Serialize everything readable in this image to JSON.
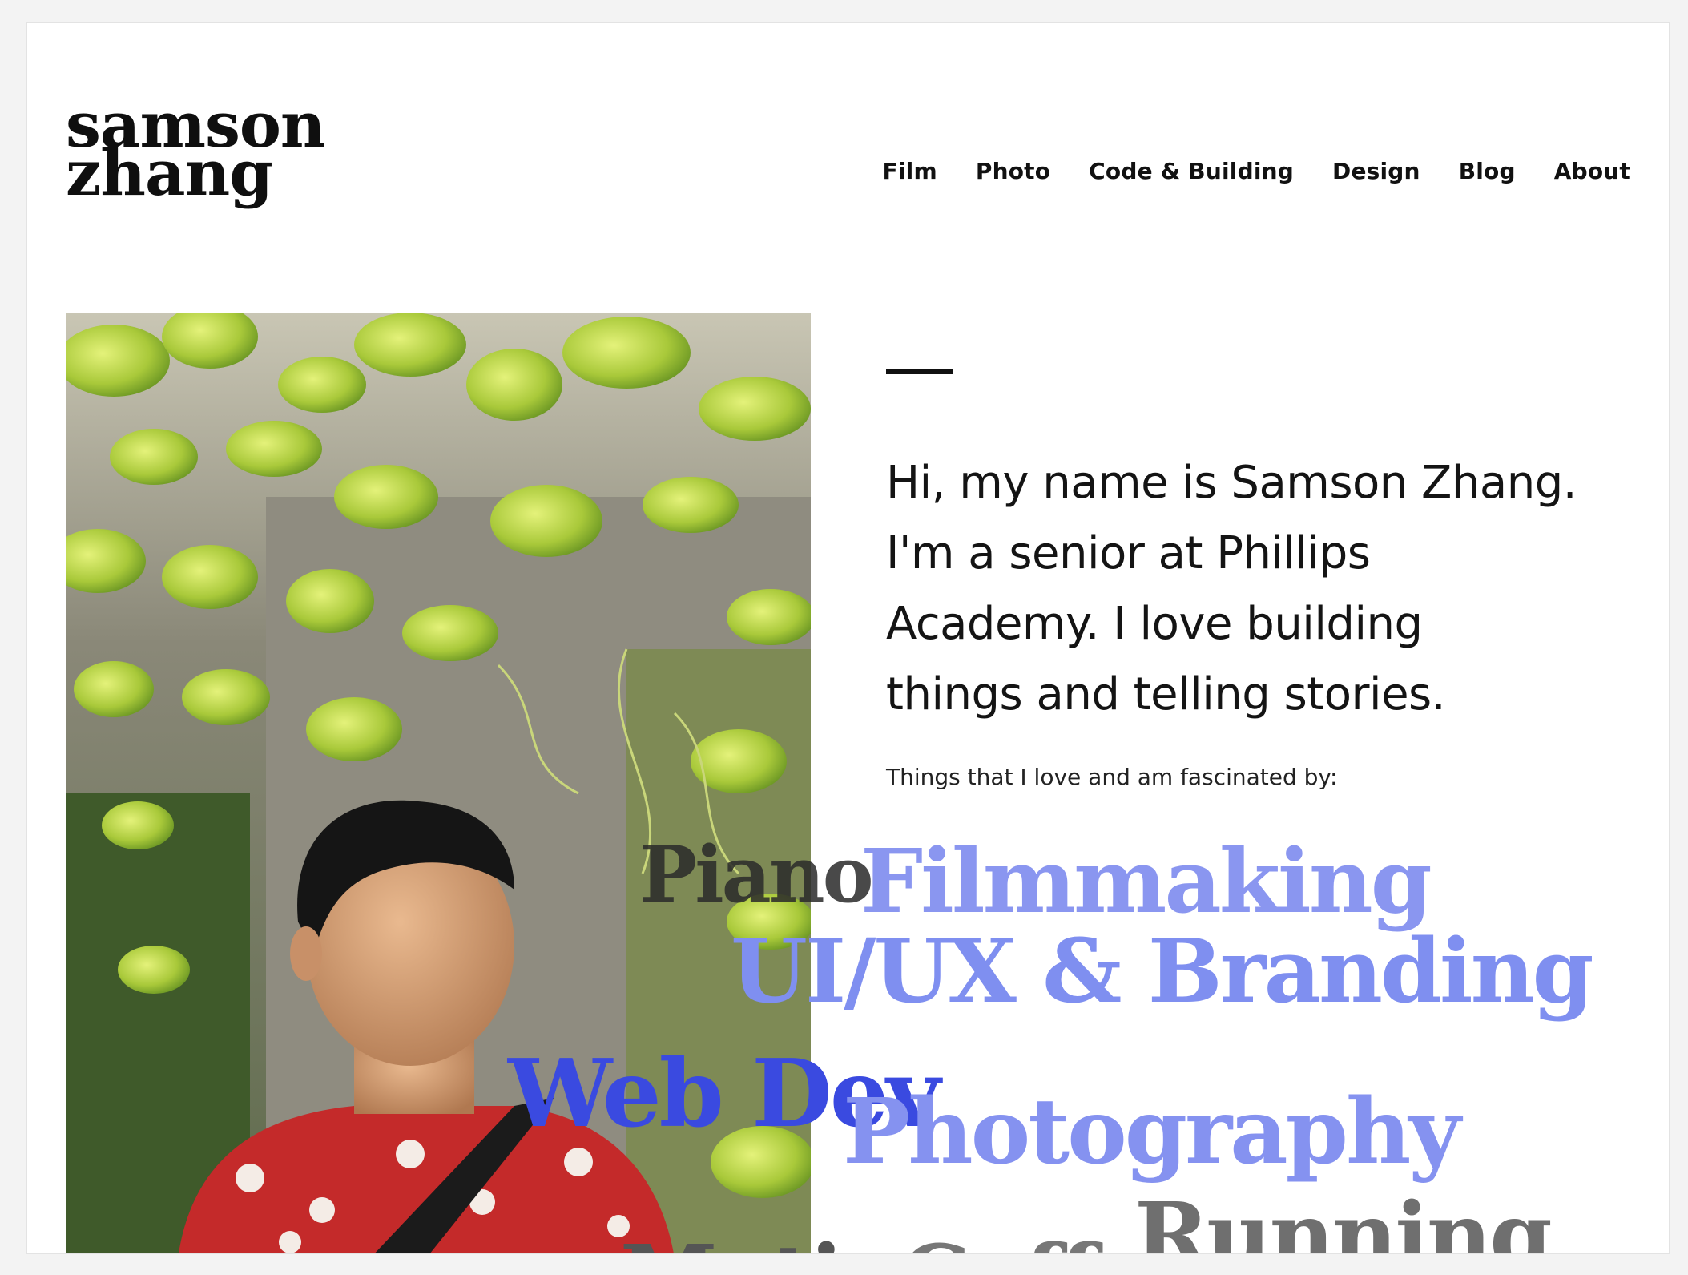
{
  "site": {
    "logo_line1": "samson",
    "logo_line2": "zhang"
  },
  "nav": {
    "items": [
      "Film",
      "Photo",
      "Code & Building",
      "Design",
      "Blog",
      "About"
    ]
  },
  "hero": {
    "intro_lines": [
      "Hi, my name is Samson Zhang.",
      "I'm a senior at Phillips",
      "Academy. I love building",
      "things and telling stories."
    ],
    "subheading": "Things that I love and am fascinated by:"
  },
  "interests": {
    "words": [
      {
        "text": "Piano",
        "color": "#2a2a2a",
        "opacity": 0.85
      },
      {
        "text": "Filmmaking",
        "color": "#8a96f0",
        "opacity": 1
      },
      {
        "text": "UI/UX & Branding",
        "color": "#7f8ff0",
        "opacity": 1
      },
      {
        "text": "Web Dev",
        "color": "#3a4ae0",
        "opacity": 1
      },
      {
        "text": "Photography",
        "color": "#8592f0",
        "opacity": 1
      },
      {
        "text": "Running",
        "color": "#6f6f6f",
        "opacity": 1
      },
      {
        "text": "Motion",
        "color": "#555555",
        "opacity": 1
      },
      {
        "text": "Coffee",
        "color": "#777777",
        "opacity": 1
      }
    ]
  },
  "colors": {
    "accent": "#8592f0",
    "text": "#111111",
    "background": "#ffffff"
  }
}
